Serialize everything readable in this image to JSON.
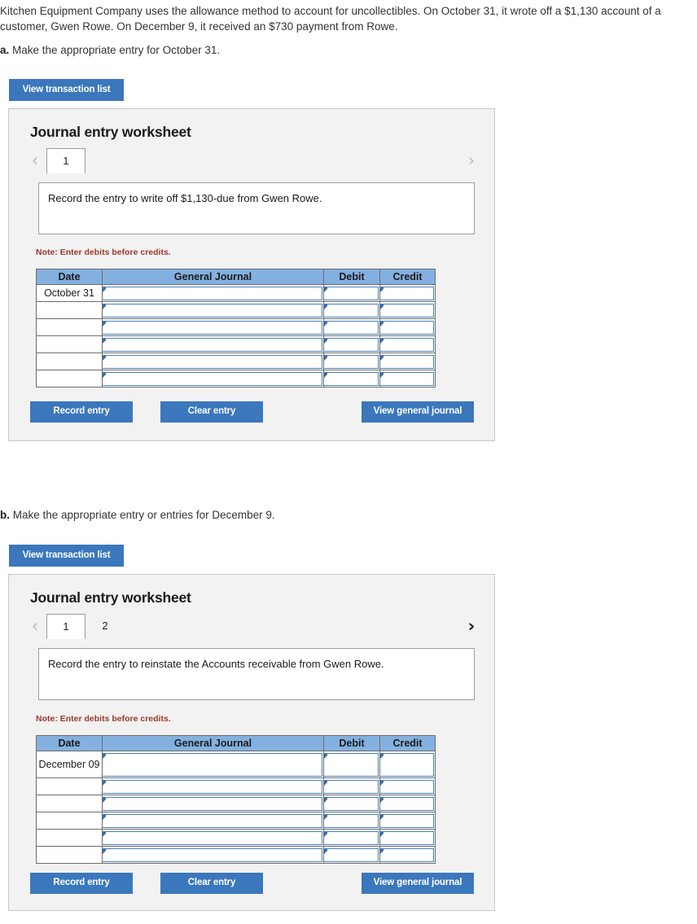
{
  "intro": "Kitchen Equipment Company uses the allowance method to account for uncollectibles. On October 31, it wrote off a $1,130 account of a customer, Gwen Rowe. On December 9, it received an $730 payment from Rowe.",
  "colors": {
    "button_blue": "#3b77bc",
    "table_header_blue": "#84b0e0",
    "note_red": "#9c3a2e",
    "panel_gray": "#f2f2f2",
    "input_border_blue": "#4a7fb5"
  },
  "parts": [
    {
      "label": "a.",
      "prompt": "Make the appropriate entry for October 31.",
      "view_transaction_list_label": "View transaction list",
      "worksheet": {
        "title": "Journal entry worksheet",
        "prev_icon": "chevron-left-icon",
        "next_icon": "chevron-right-icon",
        "prev_enabled": false,
        "next_enabled": false,
        "tabs": [
          {
            "label": "1",
            "active": true
          }
        ],
        "description": "Record the entry to write off $1,130-due from Gwen Rowe.",
        "note": "Note: Enter debits before credits.",
        "table": {
          "columns": [
            "Date",
            "General Journal",
            "Debit",
            "Credit"
          ],
          "rows": [
            {
              "date": "October 31",
              "general_journal": "",
              "debit": "",
              "credit": ""
            },
            {
              "date": "",
              "general_journal": "",
              "debit": "",
              "credit": ""
            },
            {
              "date": "",
              "general_journal": "",
              "debit": "",
              "credit": ""
            },
            {
              "date": "",
              "general_journal": "",
              "debit": "",
              "credit": ""
            },
            {
              "date": "",
              "general_journal": "",
              "debit": "",
              "credit": ""
            },
            {
              "date": "",
              "general_journal": "",
              "debit": "",
              "credit": ""
            }
          ]
        },
        "actions": {
          "record": "Record entry",
          "clear": "Clear entry",
          "view_general_journal": "View general journal"
        }
      }
    },
    {
      "label": "b.",
      "prompt": "Make the appropriate entry or entries for December 9.",
      "view_transaction_list_label": "View transaction list",
      "worksheet": {
        "title": "Journal entry worksheet",
        "prev_icon": "chevron-left-icon",
        "next_icon": "chevron-right-icon",
        "prev_enabled": false,
        "next_enabled": true,
        "tabs": [
          {
            "label": "1",
            "active": true
          },
          {
            "label": "2",
            "active": false
          }
        ],
        "description": "Record the entry to reinstate the Accounts receivable from Gwen Rowe.",
        "note": "Note: Enter debits before credits.",
        "table": {
          "columns": [
            "Date",
            "General Journal",
            "Debit",
            "Credit"
          ],
          "rows": [
            {
              "date": "December 09",
              "general_journal": "",
              "debit": "",
              "credit": ""
            },
            {
              "date": "",
              "general_journal": "",
              "debit": "",
              "credit": ""
            },
            {
              "date": "",
              "general_journal": "",
              "debit": "",
              "credit": ""
            },
            {
              "date": "",
              "general_journal": "",
              "debit": "",
              "credit": ""
            },
            {
              "date": "",
              "general_journal": "",
              "debit": "",
              "credit": ""
            },
            {
              "date": "",
              "general_journal": "",
              "debit": "",
              "credit": ""
            }
          ]
        },
        "actions": {
          "record": "Record entry",
          "clear": "Clear entry",
          "view_general_journal": "View general journal"
        }
      }
    }
  ]
}
